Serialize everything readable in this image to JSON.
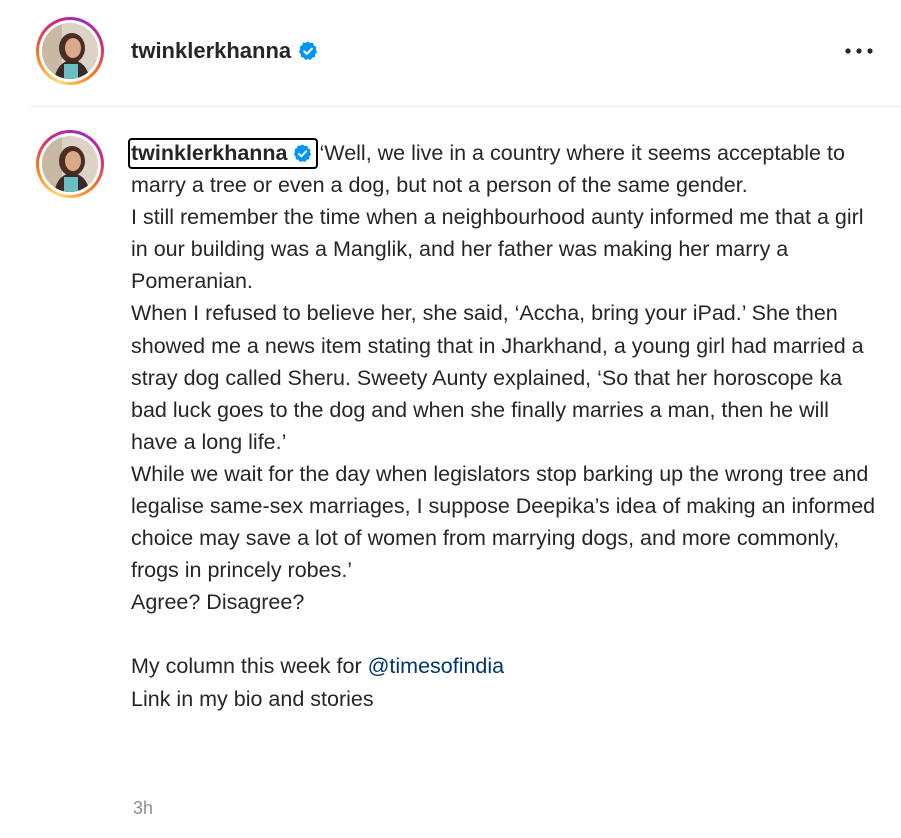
{
  "post": {
    "username": "twinklerkhanna",
    "verified": true,
    "more_icon": "more-horizontal-icon",
    "verified_icon": "verified-badge-icon"
  },
  "caption": {
    "username": "twinklerkhanna",
    "paragraphs": [
      "‘Well, we live in a country where it seems acceptable to marry a tree or even a dog, but not a person of the same gender.",
      "I still remember the time when a neighbourhood aunty informed me that a girl in our building was a Manglik, and her father was making her marry a Pomeranian.",
      "When I refused to believe her, she said, ‘Accha, bring your iPad.’ She then showed me a news item stating that in Jharkhand, a young girl had married a stray dog called Sheru. Sweety Aunty explained, ‘So that her horoscope ka bad luck goes to the dog and when she finally marries a man, then he will have a long life.’",
      "While we wait for the day when legislators stop barking up the wrong tree and legalise same-sex marriages, I suppose Deepika’s idea of making an informed choice may save a lot of women from marrying dogs, and more commonly, frogs in princely robes.’",
      "Agree? Disagree?"
    ],
    "column_prefix": "My column this week for ",
    "mention": "@timesofindia",
    "bio_line": "Link in my bio and stories"
  },
  "timestamp": "3h",
  "colors": {
    "text": "#262626",
    "mention": "#00376b",
    "verified": "#0095f6",
    "muted": "#8e8e8e"
  }
}
